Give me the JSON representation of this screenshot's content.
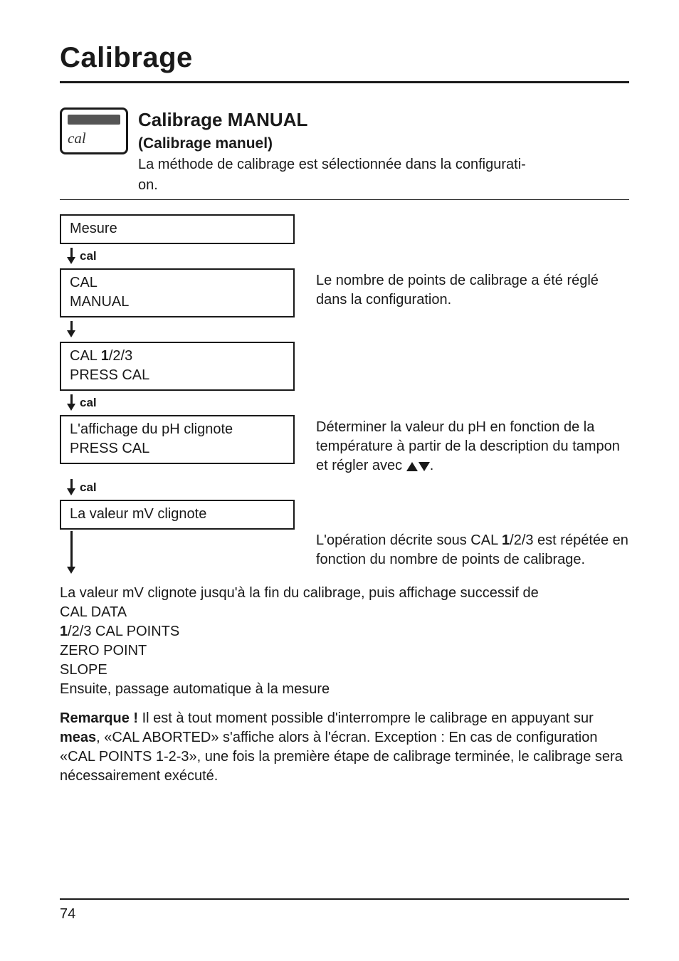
{
  "title": "Calibrage",
  "icon_label": "cal",
  "intro": {
    "heading": "Calibrage MANUAL",
    "subheading": "(Calibrage manuel)",
    "line1": "La méthode de calibrage est sélectionnée dans la configurati-",
    "line2": "on."
  },
  "cal_label": "cal",
  "steps": {
    "measure": "Mesure",
    "cal_manual_l1": "CAL",
    "cal_manual_l2": "MANUAL",
    "cal_manual_desc": "Le nombre de points de calibrage a été réglé dans la configuration.",
    "cal_123_l1": "CAL 1/2/3",
    "cal_123_bold": "1",
    "cal_123_l2": "PRESS CAL",
    "ph_l1": "L'affichage du pH clignote",
    "ph_l2": "PRESS CAL",
    "ph_desc_a": "Déterminer la valeur du pH en fonction de la température à partir de la description du tampon et régler avec ",
    "ph_desc_b": ".",
    "mv_box": "La valeur mV clignote",
    "mv_desc_a": "L'opération décrite sous CAL ",
    "mv_desc_bold": "1",
    "mv_desc_b": "/2/3 est répétée en fonction du nombre de points de calibrage."
  },
  "tail": {
    "l1": "La valeur mV clignote jusqu'à la fin du calibrage, puis affichage successif de",
    "l2": "CAL DATA",
    "l3_pre": "1",
    "l3_post": "/2/3 CAL POINTS",
    "l4": "ZERO POINT",
    "l5": "SLOPE",
    "l6": "Ensuite, passage automatique à la mesure"
  },
  "note": {
    "label": "Remarque !",
    "t1": " Il est à tout moment possible d'interrompre le calibrage en appuyant sur ",
    "bold": "meas",
    "t2": ", «CAL ABORTED» s'affiche alors à l'écran. Exception : En cas de configuration «CAL POINTS 1-2-3», une fois la première étape de calibrage terminée, le calibrage sera nécessairement exécuté."
  },
  "page_number": "74"
}
